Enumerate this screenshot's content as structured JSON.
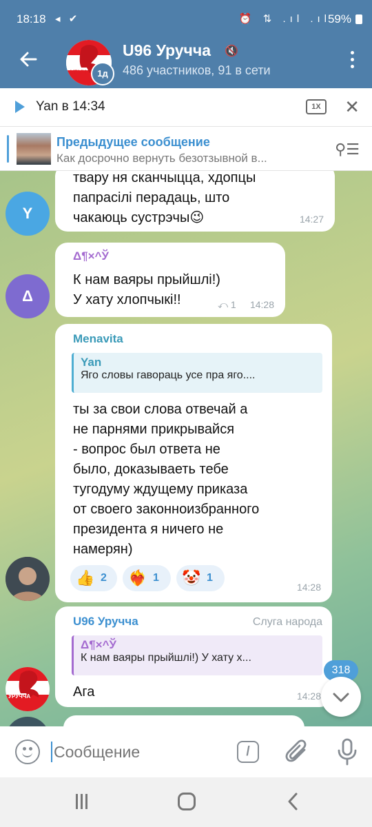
{
  "status_bar": {
    "time": "18:18",
    "battery": "59%",
    "left_icons": "◂ ✔",
    "right_icons": "⏰ ⇅ .ıl .ıl"
  },
  "header": {
    "title": "U96 Уруччa",
    "subtitle": "486 участников, 91 в сети",
    "avatar_badge": "1д",
    "avatar_text": "УРУЧ"
  },
  "player": {
    "name": "Yan в 14:34",
    "speed": "1X"
  },
  "pinned": {
    "title": "Предыдущее сообщение",
    "text": "Как досрочно вернуть безотзывной в..."
  },
  "messages": [
    {
      "avatar_letter": "Y",
      "lines": [
        "твару ня сканчыцца, хдопцы",
        "папрасілі перадаць, што",
        "чакаюць сустрэчы😉"
      ],
      "time": "14:27"
    },
    {
      "avatar_letter": "Δ",
      "sender": "Δ¶×^Ў",
      "lines": [
        "К нам ваяры прыйшлі!)",
        " У хату хлопчыкі!!"
      ],
      "reply_count": "⤺ 1",
      "time": "14:28"
    },
    {
      "sender": "Menavita",
      "reply_name": "Yan",
      "reply_text": "Яго словы гавораць усе пра яго....",
      "lines": [
        "ты за свои слова отвечай а",
        "не парнями прикрывайся",
        "- вопрос был ответа не",
        "было, доказываеть тебе",
        "тугодуму ждущему приказа",
        "от своего законноизбранного",
        "президента я ничего не",
        "намерян)"
      ],
      "reactions": [
        {
          "emoji": "👍",
          "count": "2"
        },
        {
          "emoji": "❤️‍🔥",
          "count": "1"
        },
        {
          "emoji": "🤡",
          "count": "1"
        }
      ],
      "time": "14:28"
    },
    {
      "sender": "U96 Уруччa",
      "role": "Слуга народа",
      "reply_name": "Δ¶×^Ў",
      "reply_text": "К нам ваяры прыйшлі!)   У хату х...",
      "lines": [
        "Ага"
      ],
      "time": "14:28",
      "avatar_text": "УРУЧЧА"
    }
  ],
  "unread_count": "318",
  "input": {
    "placeholder": "Сообщение",
    "command_label": "/"
  },
  "colors": {
    "header": "#4f7faa",
    "accent": "#3b8fd0",
    "avatar_y": "#4aa7e3",
    "avatar_delta": "#7e6bd0"
  }
}
